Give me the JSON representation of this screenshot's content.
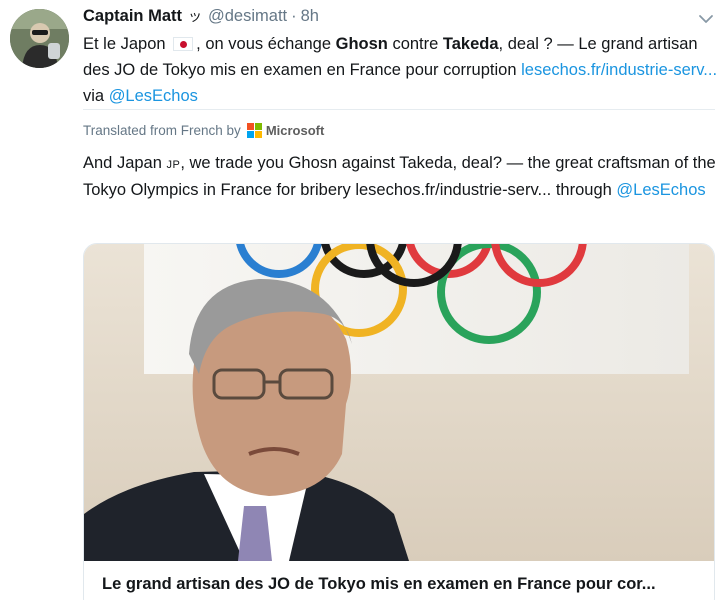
{
  "tweet": {
    "display_name": "Captain Matt",
    "name_badge": "ッ",
    "handle": "@desimatt",
    "separator": "·",
    "time": "8h",
    "text_parts": {
      "p1": "Et le Japon",
      "p2": ", on vous échange",
      "p3": "Ghosn",
      "p4": "contre",
      "p5": "Takeda",
      "p6": ", deal ? — Le grand artisan des JO de Tokyo mis en examen en France pour corruption",
      "link": "lesechos.fr/industrie-serv...",
      "via": "via",
      "mention": "@LesEchos"
    },
    "flag_icon": "japan-flag-icon"
  },
  "translation": {
    "label": "Translated from French by",
    "provider": "Microsoft",
    "text_before": "And Japan",
    "flag_text": "JP",
    "text_after": ", we trade you Ghosn against Takeda, deal? — the great craftsman of the Tokyo Olympics in France for bribery lesechos.fr/industrie-serv... through",
    "mention": "@LesEchos"
  },
  "card": {
    "title": "Le grand artisan des JO de Tokyo mis en examen en France pour cor..."
  },
  "colors": {
    "link": "#1b95e0",
    "secondary_text": "#657786",
    "primary_text": "#14171a",
    "border": "#e1e8ed",
    "ms_red": "#f25022",
    "ms_green": "#7fba00",
    "ms_blue": "#00a4ef",
    "ms_yellow": "#ffb900"
  }
}
